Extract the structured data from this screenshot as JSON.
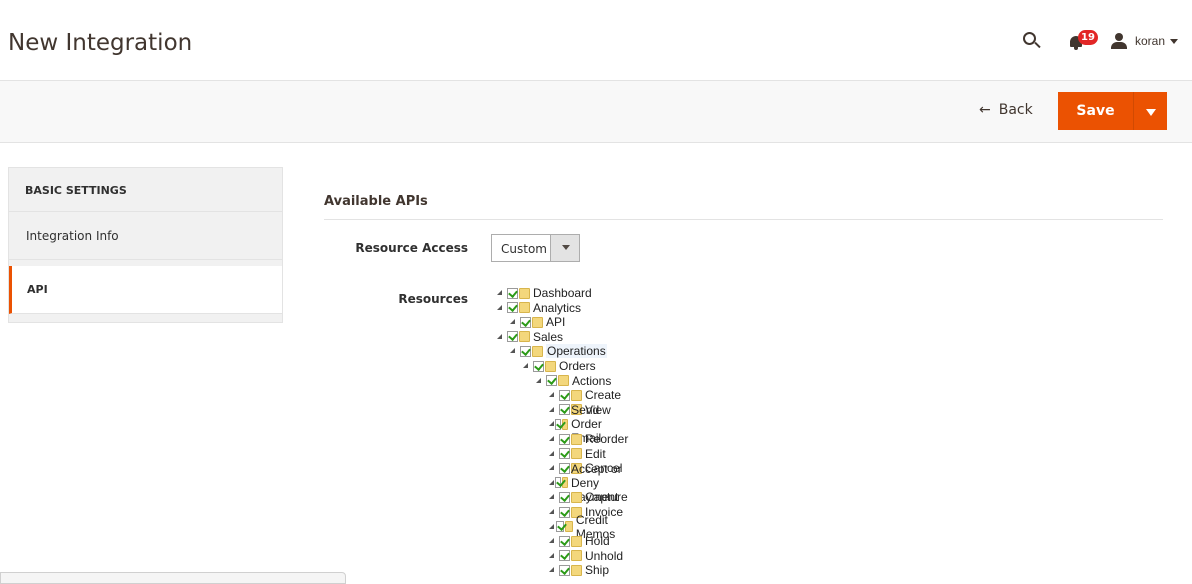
{
  "header": {
    "title": "New Integration",
    "notification_count": "19",
    "user_name": "koran"
  },
  "actions": {
    "back_label": "Back",
    "save_label": "Save"
  },
  "sidebar": {
    "title": "BASIC SETTINGS",
    "items": [
      {
        "label": "Integration Info"
      },
      {
        "label": "API"
      }
    ]
  },
  "main": {
    "section_title": "Available APIs",
    "resource_access_label": "Resource Access",
    "resource_access_value": "Custom",
    "resources_label": "Resources",
    "tree": [
      {
        "label": "Dashboard",
        "level": 0
      },
      {
        "label": "Analytics",
        "level": 0
      },
      {
        "label": "API",
        "level": 1
      },
      {
        "label": "Sales",
        "level": 0
      },
      {
        "label": "Operations",
        "level": 1
      },
      {
        "label": "Orders",
        "level": 2
      },
      {
        "label": "Actions",
        "level": 3
      },
      {
        "label": "Create",
        "level": 4
      },
      {
        "label": "View",
        "level": 4
      },
      {
        "label": "Send Order Email",
        "level": 4
      },
      {
        "label": "Reorder",
        "level": 4
      },
      {
        "label": "Edit",
        "level": 4
      },
      {
        "label": "Cancel",
        "level": 4
      },
      {
        "label": "Accept or Deny Payment",
        "level": 4
      },
      {
        "label": "Capture",
        "level": 4
      },
      {
        "label": "Invoice",
        "level": 4
      },
      {
        "label": "Credit Memos",
        "level": 4
      },
      {
        "label": "Hold",
        "level": 4
      },
      {
        "label": "Unhold",
        "level": 4
      },
      {
        "label": "Ship",
        "level": 4
      }
    ]
  },
  "colors": {
    "accent": "#eb5202",
    "badge": "#e22626",
    "check": "#2c9b18"
  }
}
